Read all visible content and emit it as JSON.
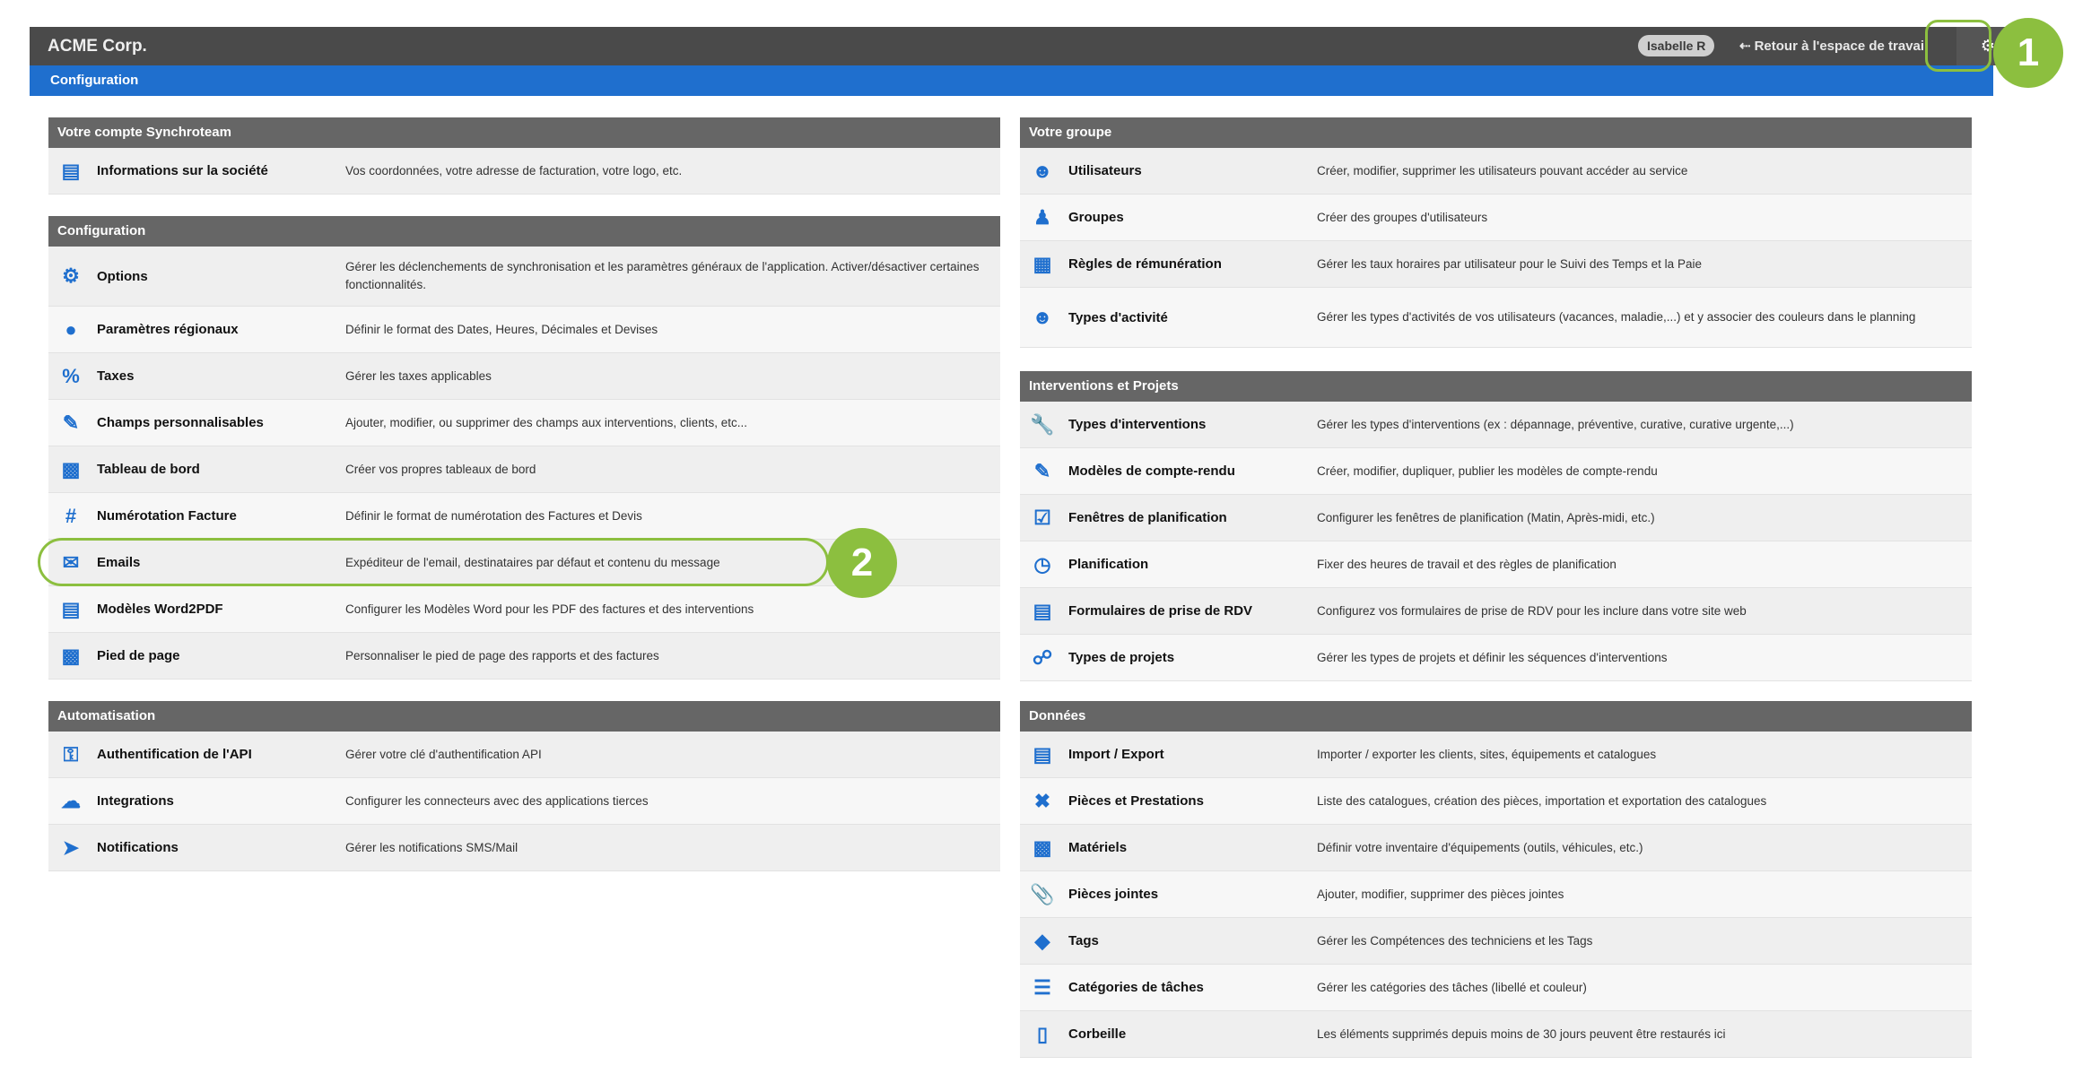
{
  "header": {
    "brand": "ACME Corp.",
    "user": "Isabelle R",
    "back_arrow": "⇠",
    "back_label": "Retour à l'espace de travail",
    "settings_icon": "gear-icon"
  },
  "subheader": {
    "title": "Configuration"
  },
  "badges": {
    "one": "1",
    "two": "2"
  },
  "left": {
    "account": {
      "title": "Votre compte Synchroteam",
      "rows": [
        {
          "icon": "id-card-icon",
          "label": "Informations sur la société",
          "desc": "Vos coordonnées, votre adresse de facturation, votre logo, etc."
        }
      ]
    },
    "config": {
      "title": "Configuration",
      "rows": [
        {
          "icon": "gear-icon",
          "label": "Options",
          "desc": "Gérer les déclenchements de synchronisation et les paramètres généraux de l'application. Activer/désactiver certaines fonctionnalités."
        },
        {
          "icon": "globe-icon",
          "label": "Paramètres régionaux",
          "desc": "Définir le format des Dates, Heures, Décimales et Devises"
        },
        {
          "icon": "percent-icon",
          "label": "Taxes",
          "desc": "Gérer les taxes applicables"
        },
        {
          "icon": "edit-icon",
          "label": "Champs personnalisables",
          "desc": "Ajouter, modifier, ou supprimer des champs aux interventions, clients, etc..."
        },
        {
          "icon": "dashboard-file-icon",
          "label": "Tableau de bord",
          "desc": "Créer vos propres tableaux de bord"
        },
        {
          "icon": "hash-icon",
          "label": "Numérotation Facture",
          "desc": "Définir le format de numérotation des Factures et Devis"
        },
        {
          "icon": "envelope-icon",
          "label": "Emails",
          "desc": "Expéditeur de l'email, destinataires par défaut et contenu du message"
        },
        {
          "icon": "pdf-file-icon",
          "label": "Modèles Word2PDF",
          "desc": "Configurer les Modèles Word pour les PDF des factures et des interventions"
        },
        {
          "icon": "footer-file-icon",
          "label": "Pied de page",
          "desc": "Personnaliser le pied de page des rapports et des factures"
        }
      ]
    },
    "automation": {
      "title": "Automatisation",
      "rows": [
        {
          "icon": "key-icon",
          "label": "Authentification de l'API",
          "desc": "Gérer votre clé d'authentification API"
        },
        {
          "icon": "cloud-icon",
          "label": "Integrations",
          "desc": "Configurer les connecteurs avec des applications tierces"
        },
        {
          "icon": "paper-plane-icon",
          "label": "Notifications",
          "desc": "Gérer les notifications SMS/Mail"
        }
      ]
    }
  },
  "right": {
    "group": {
      "title": "Votre groupe",
      "rows": [
        {
          "icon": "user-edit-icon",
          "label": "Utilisateurs",
          "desc": "Créer, modifier, supprimer les utilisateurs pouvant accéder au service"
        },
        {
          "icon": "users-icon",
          "label": "Groupes",
          "desc": "Créer des groupes d'utilisateurs"
        },
        {
          "icon": "money-icon",
          "label": "Règles de rémunération",
          "desc": "Gérer les taux horaires par utilisateur pour le Suivi des Temps et la Paie"
        },
        {
          "icon": "user-clock-icon",
          "label": "Types d'activité",
          "desc": "Gérer les types d'activités de vos utilisateurs (vacances, maladie,...) et y associer des couleurs dans le planning"
        }
      ]
    },
    "projects": {
      "title": "Interventions et Projets",
      "rows": [
        {
          "icon": "wrench-icon",
          "label": "Types d'interventions",
          "desc": "Gérer les types d'interventions (ex : dépannage, préventive, curative, curative urgente,...)"
        },
        {
          "icon": "report-edit-icon",
          "label": "Modèles de compte-rendu",
          "desc": "Créer, modifier, dupliquer, publier les modèles de compte-rendu"
        },
        {
          "icon": "calendar-check-icon",
          "label": "Fenêtres de planification",
          "desc": "Configurer les fenêtres de planification (Matin, Après-midi, etc.)"
        },
        {
          "icon": "clock-icon",
          "label": "Planification",
          "desc": "Fixer des heures de travail et des règles de planification"
        },
        {
          "icon": "clipboard-icon",
          "label": "Formulaires de prise de RDV",
          "desc": "Configurez vos formulaires de prise de RDV pour les inclure dans votre site web"
        },
        {
          "icon": "project-diagram-icon",
          "label": "Types de projets",
          "desc": "Gérer les types de projets et définir les séquences d'interventions"
        }
      ]
    },
    "data": {
      "title": "Données",
      "rows": [
        {
          "icon": "csv-file-icon",
          "label": "Import / Export",
          "desc": "Importer / exporter les clients, sites, équipements et catalogues"
        },
        {
          "icon": "tools-icon",
          "label": "Pièces et Prestations",
          "desc": "Liste des catalogues, création des pièces, importation et exportation des catalogues"
        },
        {
          "icon": "briefcase-icon",
          "label": "Matériels",
          "desc": "Définir votre inventaire d'équipements (outils, véhicules, etc.)"
        },
        {
          "icon": "paperclip-icon",
          "label": "Pièces jointes",
          "desc": "Ajouter, modifier, supprimer des pièces jointes"
        },
        {
          "icon": "tags-icon",
          "label": "Tags",
          "desc": "Gérer les Compétences des techniciens et les Tags"
        },
        {
          "icon": "list-icon",
          "label": "Catégories de tâches",
          "desc": "Gérer les catégories des tâches (libellé et couleur)"
        },
        {
          "icon": "trash-icon",
          "label": "Corbeille",
          "desc": "Les éléments supprimés depuis moins de 30 jours peuvent être restaurés ici"
        }
      ]
    }
  }
}
